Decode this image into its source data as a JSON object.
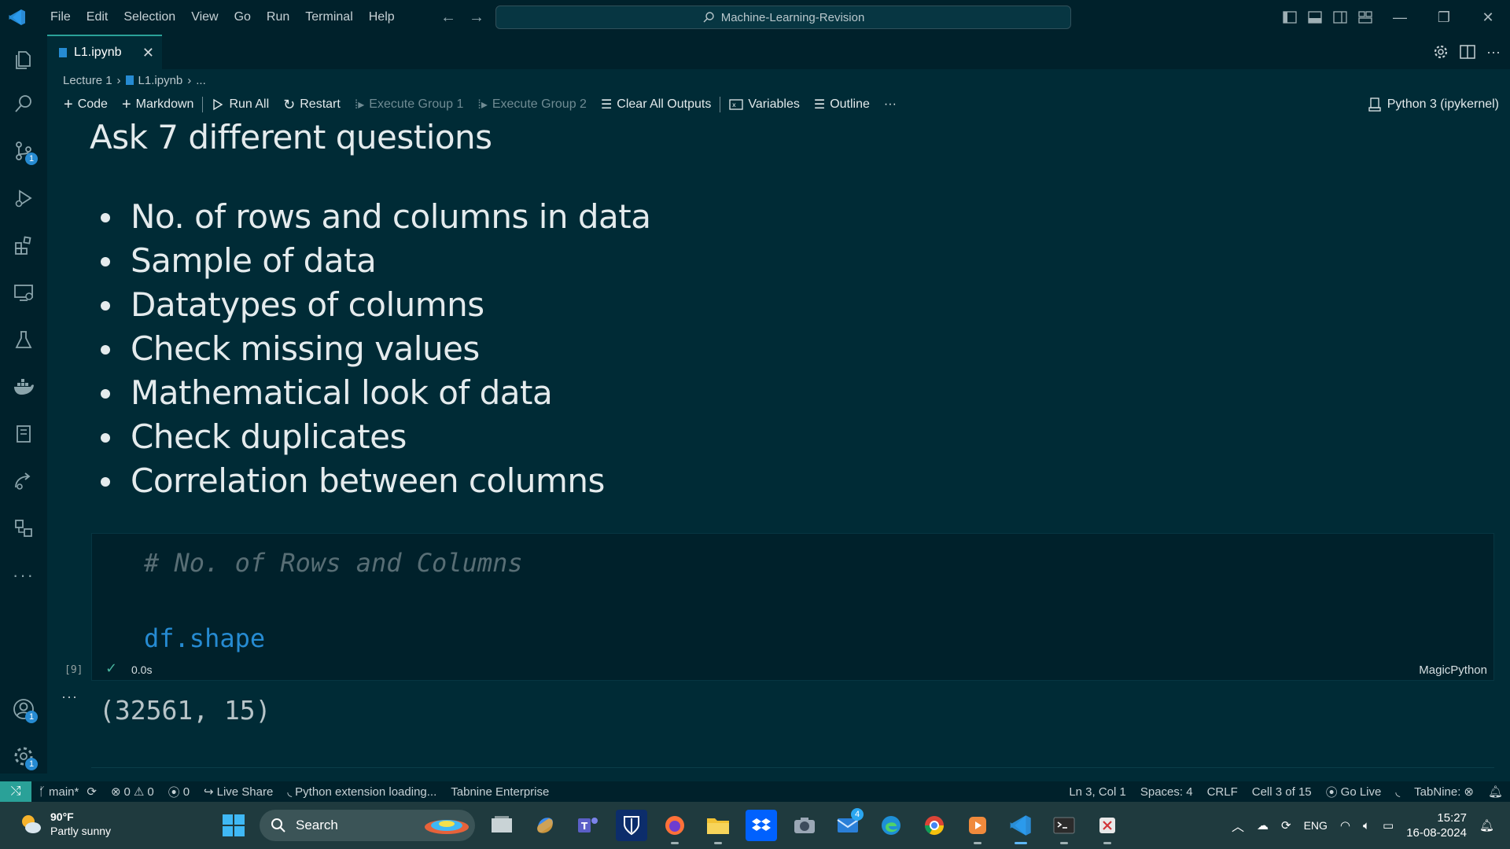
{
  "menu": [
    "File",
    "Edit",
    "Selection",
    "View",
    "Go",
    "Run",
    "Terminal",
    "Help"
  ],
  "command_center": "Machine-Learning-Revision",
  "tab": {
    "label": "L1.ipynb",
    "close": "✕"
  },
  "breadcrumb": {
    "folder": "Lecture 1",
    "file": "L1.ipynb",
    "more": "..."
  },
  "toolbar": {
    "code": "Code",
    "markdown": "Markdown",
    "run_all": "Run All",
    "restart": "Restart",
    "execute_group_1": "Execute Group 1",
    "execute_group_2": "Execute Group 2",
    "clear_all": "Clear All Outputs",
    "variables": "Variables",
    "outline": "Outline",
    "more": "···"
  },
  "kernel": "Python 3 (ipykernel)",
  "markdown_cell": {
    "heading": "Ask 7 different questions",
    "items": [
      "No. of rows and columns in data",
      "Sample of data",
      "Datatypes of columns",
      "Check missing values",
      "Mathematical look of data",
      "Check duplicates",
      "Correlation between columns"
    ]
  },
  "code_cell": {
    "comment": "# No. of Rows and Columns",
    "code": "df.shape",
    "language": "MagicPython",
    "exec_count": "[9]",
    "exec_time": "0.0s",
    "output_more": "···",
    "output": "(32561, 15)"
  },
  "activity_badges": {
    "source_control": "1",
    "accounts": "1",
    "manage": "1"
  },
  "status": {
    "branch": "main*",
    "errors": "0",
    "warnings": "0",
    "ports": "0",
    "live_share": "Live Share",
    "python_loading": "Python extension loading...",
    "tabnine_enterprise": "Tabnine Enterprise",
    "position": "Ln 3, Col 1",
    "spaces": "Spaces: 4",
    "eol": "CRLF",
    "cell": "Cell 3 of 15",
    "go_live": "Go Live",
    "tabnine": "TabNine:"
  },
  "taskbar": {
    "temperature": "90°F",
    "weather": "Partly sunny",
    "search": "Search",
    "mail_badge": "4",
    "lang": "ENG",
    "time": "15:27",
    "date": "16-08-2024"
  },
  "colors": {
    "accent": "#2aa198",
    "background": "#002b36",
    "keyword_blue": "#268bd2",
    "comment": "#586e75"
  }
}
